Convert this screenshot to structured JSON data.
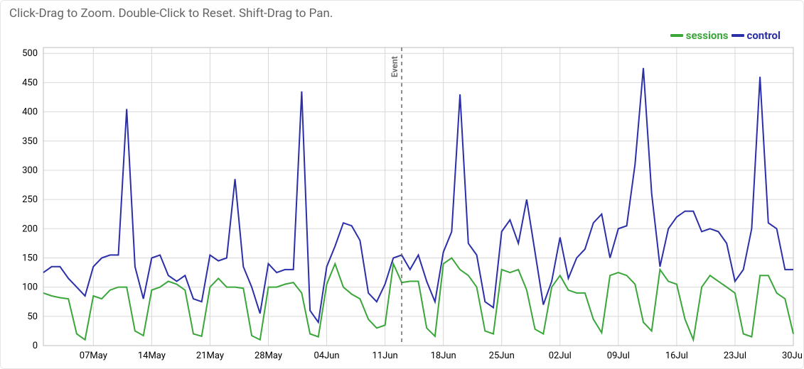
{
  "hint_text": "Click-Drag to Zoom. Double-Click to Reset. Shift-Drag to Pan.",
  "legend": {
    "items": [
      {
        "name": "sessions",
        "color": "#3aa63a"
      },
      {
        "name": "control",
        "color": "#2b2fa8"
      }
    ]
  },
  "event": {
    "label": "Event",
    "x_index": 43
  },
  "chart_data": {
    "type": "line",
    "xlabel": "",
    "ylabel": "",
    "ylim": [
      0,
      510
    ],
    "xticks_labels": [
      "07May",
      "14May",
      "21May",
      "28May",
      "04Jun",
      "11Jun",
      "18Jun",
      "25Jun",
      "02Jul",
      "09Jul",
      "16Jul",
      "23Jul",
      "30Jul"
    ],
    "xticks_index": [
      6,
      13,
      20,
      27,
      34,
      41,
      48,
      55,
      62,
      69,
      76,
      83,
      90
    ],
    "yticks": [
      0,
      50,
      100,
      150,
      200,
      250,
      300,
      350,
      400,
      450,
      500
    ],
    "x": [
      0,
      1,
      2,
      3,
      4,
      5,
      6,
      7,
      8,
      9,
      10,
      11,
      12,
      13,
      14,
      15,
      16,
      17,
      18,
      19,
      20,
      21,
      22,
      23,
      24,
      25,
      26,
      27,
      28,
      29,
      30,
      31,
      32,
      33,
      34,
      35,
      36,
      37,
      38,
      39,
      40,
      41,
      42,
      43,
      44,
      45,
      46,
      47,
      48,
      49,
      50,
      51,
      52,
      53,
      54,
      55,
      56,
      57,
      58,
      59,
      60,
      61,
      62,
      63,
      64,
      65,
      66,
      67,
      68,
      69,
      70,
      71,
      72,
      73,
      74,
      75,
      76,
      77,
      78,
      79,
      80,
      81,
      82,
      83,
      84,
      85,
      86,
      87,
      88,
      89,
      90
    ],
    "series": [
      {
        "name": "sessions",
        "color": "#3aa63a",
        "values": [
          90,
          85,
          82,
          80,
          20,
          10,
          85,
          80,
          95,
          100,
          100,
          25,
          17,
          95,
          100,
          110,
          105,
          95,
          20,
          16,
          100,
          115,
          100,
          100,
          98,
          17,
          10,
          100,
          100,
          105,
          108,
          90,
          20,
          15,
          105,
          140,
          100,
          88,
          80,
          45,
          30,
          35,
          140,
          108,
          110,
          110,
          30,
          16,
          140,
          150,
          130,
          120,
          100,
          25,
          20,
          130,
          125,
          130,
          95,
          28,
          20,
          100,
          120,
          95,
          90,
          90,
          45,
          22,
          120,
          125,
          120,
          105,
          40,
          25,
          130,
          110,
          105,
          45,
          10,
          100,
          120,
          110,
          100,
          90,
          20,
          15,
          120,
          120,
          90,
          80,
          20
        ]
      },
      {
        "name": "control",
        "color": "#2b2fa8",
        "values": [
          125,
          135,
          135,
          115,
          100,
          85,
          135,
          150,
          155,
          155,
          405,
          135,
          80,
          150,
          155,
          120,
          110,
          120,
          80,
          75,
          155,
          145,
          150,
          285,
          135,
          100,
          55,
          140,
          125,
          130,
          130,
          435,
          60,
          40,
          135,
          170,
          210,
          205,
          180,
          90,
          75,
          105,
          150,
          155,
          130,
          155,
          110,
          75,
          160,
          195,
          430,
          175,
          155,
          75,
          65,
          195,
          215,
          175,
          250,
          160,
          70,
          110,
          185,
          115,
          150,
          165,
          210,
          225,
          150,
          200,
          205,
          310,
          475,
          260,
          135,
          200,
          220,
          230,
          230,
          195,
          200,
          195,
          175,
          110,
          130,
          200,
          460,
          210,
          200,
          130,
          130
        ]
      }
    ]
  }
}
